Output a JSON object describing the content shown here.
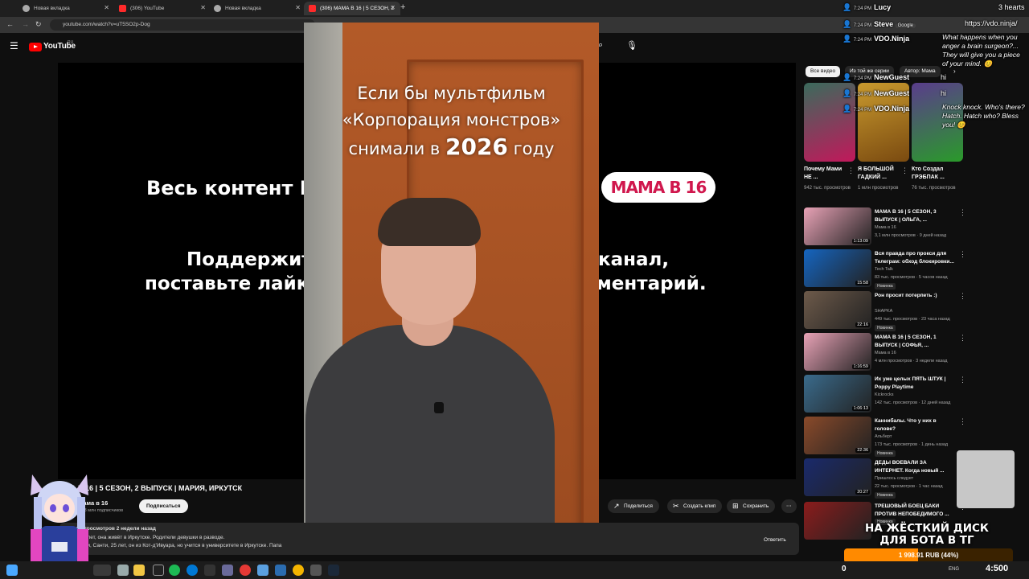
{
  "browser": {
    "tabs": [
      {
        "label": "Новая вкладка",
        "favicon": "globe-icon"
      },
      {
        "label": "(306) YouTube",
        "favicon": "youtube-icon"
      },
      {
        "label": "Новая вкладка",
        "favicon": "globe-icon"
      },
      {
        "label": "(306) МАМА В 16 | 5 СЕЗОН, 2",
        "favicon": "youtube-icon"
      }
    ],
    "new_tab": "+",
    "url": "youtube.com/watch?v=uT5SO2p-Dog"
  },
  "youtube": {
    "logo_text": "YouTube",
    "region": "RU"
  },
  "player": {
    "bg_line1": "Весь контент Ю",
    "bg_line2": "Поддержит",
    "bg_line3": "поставьте лайк",
    "bg_line2_right": "канал,",
    "bg_line3_right": "ментарий.",
    "badge": "МАМА В 16"
  },
  "overlay_clip": {
    "line1": "Если бы мультфильм",
    "line2": "«Корпорация монстров»",
    "line3_pre": "снимали в ",
    "line3_year": "2026",
    "line3_post": " году"
  },
  "video": {
    "title": "А В 16 | 5 СЕЗОН, 2 ВЫПУСК | МАРИЯ, ИРКУТСК",
    "channel": "Мама в 16",
    "subscribers": "1,38 млн подписчиков",
    "subscribe": "Подписаться",
    "share": "Поделиться",
    "clip": "Создать клип",
    "save": "Сохранить",
    "desc_line1": "лн просмотров  2 недели назад",
    "desc_line2": "и 17 лет, она живёт в Иркутске. Родители девушки в разводе.",
    "desc_line3": "Маши, Санти, 25 лет, он из Кот-д'Ивуара, но учится в университете в Иркутске. Папа",
    "reply": "Ответить"
  },
  "sidebar": {
    "chips": [
      "Все видео",
      "Из той же серии",
      "Автор: Мама"
    ],
    "shorts": [
      {
        "title": "Почему Мами НЕ ...",
        "views": "942 тыс. просмотров",
        "color": "#c2185b"
      },
      {
        "title": "Я БОЛЬШОЙ ГАДКИЙ ...",
        "views": "1 млн просмотров",
        "color": "#c99a2e"
      },
      {
        "title": "Кто Создал ГРЭБПАК ...",
        "views": "76 тыс. просмотров",
        "color": "#5a3c8c"
      }
    ],
    "videos": [
      {
        "title": "МАМА В 16 | 5 СЕЗОН, 3 ВЫПУСК | ОЛЬГА, ...",
        "channel": "Мама в 16",
        "meta": "3,1 млн просмотров · 9 дней назад",
        "duration": "1:13:09",
        "new": "",
        "color": "#e8a2b6"
      },
      {
        "title": "Вся правда про прокси для Телеграм: обход блокировки...",
        "channel": "Tech Talk",
        "meta": "83 тыс. просмотров · 5 часов назад",
        "duration": "15:58",
        "new": "Новинка",
        "color": "#1565c0"
      },
      {
        "title": "Рон просит потерпеть :)",
        "channel": "SHAPKA",
        "meta": "449 тыс. просмотров · 23 часа назад",
        "duration": "22:16",
        "new": "Новинка",
        "color": "#6d5a4a"
      },
      {
        "title": "МАМА В 16 | 5 СЕЗОН, 1 ВЫПУСК | СОФЬЯ, ...",
        "channel": "Мама в 16",
        "meta": "4 млн просмотров · 3 недели назад",
        "duration": "1:16:59",
        "new": "",
        "color": "#e8a2b6"
      },
      {
        "title": "Их уже целых ПЯТЬ ШТУК | Poppy Playtime",
        "channel": "Kickrocks",
        "meta": "142 тыс. просмотров · 12 дней назад",
        "duration": "1:06:13",
        "new": "",
        "color": "#3a6b8c"
      },
      {
        "title": "Каннибалы. Что у них в голове?",
        "channel": "Альберт",
        "meta": "173 тыс. просмотров · 1 день назад",
        "duration": "22:36",
        "new": "Новинка",
        "color": "#8a4a2a"
      },
      {
        "title": "ДЕДЫ ВОЕВАЛИ ЗА ИНТЕРНЕТ. Когда новый ...",
        "channel": "Пришлось следует",
        "meta": "22 тыс. просмотров · 1 час назад",
        "duration": "20:27",
        "new": "Новинка",
        "color": "#1a2a6c"
      },
      {
        "title": "ТРЕШОВЫЙ БОЕЦ БАКИ ПРОТИВ НЕПОБЕДИМОГО ...",
        "channel": "",
        "meta": "",
        "duration": "",
        "new": "Новинка",
        "color": "#8b1c1c"
      }
    ]
  },
  "chat": [
    {
      "time": "7:24 PM",
      "name": "Lucy"
    },
    {
      "time": "7:24 PM",
      "name": "Steve"
    },
    {
      "time": "7:24 PM",
      "name": "VDO.Ninja"
    },
    {
      "time": "7:24 PM",
      "name": "NewGuest"
    },
    {
      "time": "7:24 PM",
      "name": "NewGuest"
    },
    {
      "time": "7:24 PM",
      "name": "VDO.Ninja"
    }
  ],
  "chat_msgs": {
    "hearts": "3 hearts",
    "steve_msg": "https://vdo.ninja/",
    "ninja_msg": "What happens when you anger a brain surgeon?... They will give you a piece of your mind. 😊",
    "hi1": "hi",
    "hi2": "hi",
    "knock": "Knock knock. Who's there? Hatch. Hatch who? Bless you! 😊",
    "google": "Google"
  },
  "donation": {
    "text": "НА ЖЁСТКИЙ ДИСК ДЛЯ БОТА В ТГ",
    "amount": "1 998.91 RUB (44%)",
    "progress": 0.44
  },
  "taskbar": {
    "zero": "0",
    "lang": "ENG",
    "clock": "4:500"
  }
}
